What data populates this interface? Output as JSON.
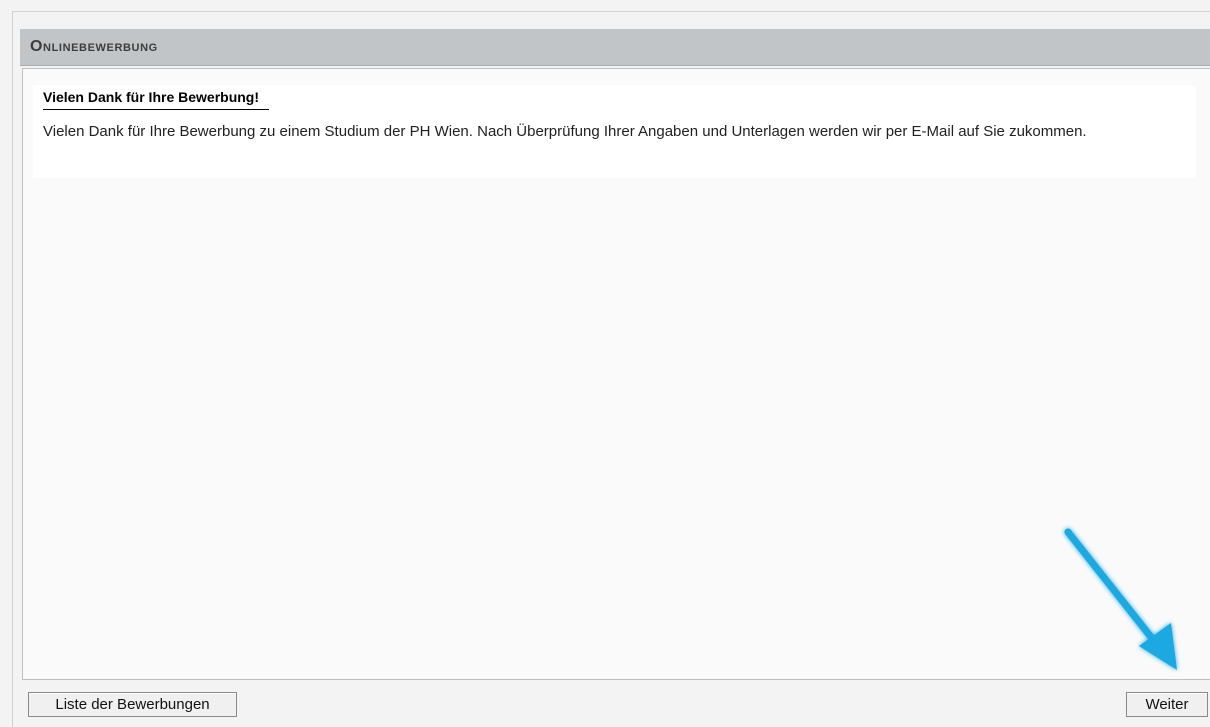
{
  "header": {
    "title": "Onlinebewerbung"
  },
  "message": {
    "heading": "Vielen Dank für Ihre Bewerbung!",
    "body": "Vielen Dank für Ihre Bewerbung zu einem Studium der PH Wien. Nach Überprüfung Ihrer Angaben und Unterlagen werden wir per E-Mail auf Sie zukommen."
  },
  "footer": {
    "list_button_label": "Liste der Bewerbungen",
    "next_button_label": "Weiter"
  },
  "annotation": {
    "arrow_color": "#1ba8e0",
    "arrow_icon": "pointer-arrow-icon"
  }
}
